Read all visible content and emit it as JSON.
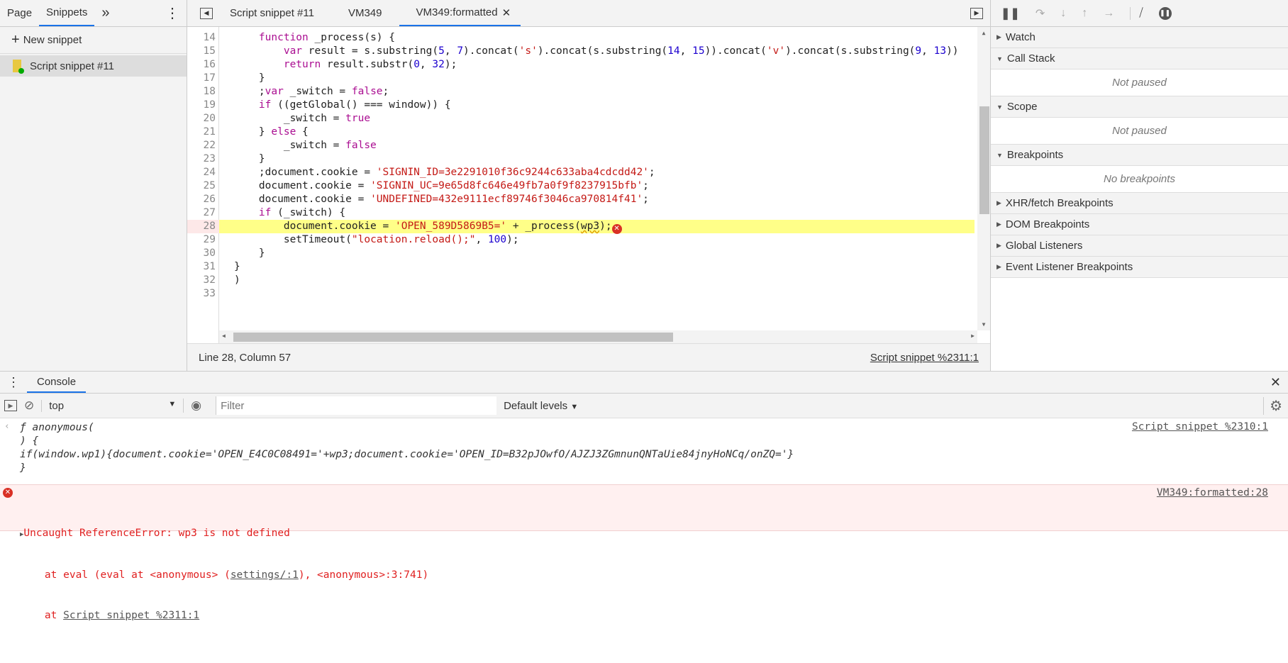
{
  "navigator": {
    "tabs": [
      "Page",
      "Snippets"
    ],
    "more": "»",
    "new_snippet": "New snippet",
    "items": [
      {
        "label": "Script snippet #11"
      }
    ]
  },
  "editor": {
    "tabs": [
      "Script snippet #11",
      "VM349",
      "VM349:formatted"
    ],
    "lines": [
      {
        "n": "14",
        "html": "    <span class='kw'>function</span> _process(s) {"
      },
      {
        "n": "15",
        "html": "        <span class='kw'>var</span> result = s.substring(<span class='nm'>5</span>, <span class='nm'>7</span>).concat(<span class='str'>'s'</span>).concat(s.substring(<span class='nm'>14</span>, <span class='nm'>15</span>)).concat(<span class='str'>'v'</span>).concat(s.substring(<span class='nm'>9</span>, <span class='nm'>13</span>))"
      },
      {
        "n": "16",
        "html": "        <span class='kw'>return</span> result.substr(<span class='nm'>0</span>, <span class='nm'>32</span>);"
      },
      {
        "n": "17",
        "html": "    }"
      },
      {
        "n": "18",
        "html": "    ;<span class='kw'>var</span> _switch = <span class='kw'>false</span>;"
      },
      {
        "n": "19",
        "html": "    <span class='kw'>if</span> ((getGlobal() === window)) {"
      },
      {
        "n": "20",
        "html": "        _switch = <span class='kw'>true</span>"
      },
      {
        "n": "21",
        "html": "    } <span class='kw'>else</span> {"
      },
      {
        "n": "22",
        "html": "        _switch = <span class='kw'>false</span>"
      },
      {
        "n": "23",
        "html": "    }"
      },
      {
        "n": "24",
        "html": "    ;document.cookie = <span class='str'>'SIGNIN_ID=3e2291010f36c9244c633aba4cdcdd42'</span>;"
      },
      {
        "n": "25",
        "html": "    document.cookie = <span class='str'>'SIGNIN_UC=9e65d8fc646e49fb7a0f9f8237915bfb'</span>;"
      },
      {
        "n": "26",
        "html": "    document.cookie = <span class='str'>'UNDEFINED=432e9111ecf89746f3046ca970814f41'</span>;"
      },
      {
        "n": "27",
        "html": "    <span class='kw'>if</span> (_switch) {"
      },
      {
        "n": "28",
        "html": "        document.cookie = <span class='str'>'OPEN_589D5869B5='</span> + _process(<span style='text-decoration:underline wavy #e0a000'>wp3</span>);<span style='display:inline-block;width:14px;height:14px;border-radius:7px;background:#d93025;color:#fff;font-size:10px;line-height:14px;text-align:center;font-family:DejaVu Sans,sans-serif;vertical-align:-2px'>✕</span>",
        "highlight": true
      },
      {
        "n": "29",
        "html": "        setTimeout(<span class='str'>\"location.reload();\"</span>, <span class='nm'>100</span>);"
      },
      {
        "n": "30",
        "html": "    }"
      },
      {
        "n": "31",
        "html": "}"
      },
      {
        "n": "32",
        "html": ")"
      },
      {
        "n": "33",
        "html": ""
      }
    ],
    "status_position": "Line 28, Column 57",
    "status_source": "Script snippet %2311:1"
  },
  "debugger": {
    "sections": [
      {
        "label": "Watch",
        "expanded": false
      },
      {
        "label": "Call Stack",
        "expanded": true,
        "empty": "Not paused"
      },
      {
        "label": "Scope",
        "expanded": true,
        "empty": "Not paused"
      },
      {
        "label": "Breakpoints",
        "expanded": true,
        "empty": "No breakpoints"
      },
      {
        "label": "XHR/fetch Breakpoints",
        "expanded": false
      },
      {
        "label": "DOM Breakpoints",
        "expanded": false
      },
      {
        "label": "Global Listeners",
        "expanded": false
      },
      {
        "label": "Event Listener Breakpoints",
        "expanded": false
      }
    ]
  },
  "console": {
    "tab": "Console",
    "context": "top",
    "filter_placeholder": "Filter",
    "levels": "Default levels",
    "result": {
      "lines": [
        "ƒ anonymous(",
        ") {",
        "if(window.wp1){document.cookie='OPEN_E4C0C08491='+wp3;document.cookie='OPEN_ID=B32pJOwfO/AJZJ3ZGmnunQNTaUie84jnyHoNCq/onZQ='}",
        "}"
      ],
      "source": "Script snippet %2310:1"
    },
    "error": {
      "message": "Uncaught ReferenceError: wp3 is not defined",
      "stack1_pre": "    at eval (eval at <anonymous> (",
      "stack1_link": "settings/:1",
      "stack1_post": "), <anonymous>:3:741)",
      "stack2_pre": "    at ",
      "stack2_link": "Script snippet %2311:1",
      "source": "VM349:formatted:28"
    }
  },
  "colors": {
    "accent": "#1a73e8",
    "highlight": "#ffff88",
    "error_bg": "#fff0f0",
    "error_text": "#e02020"
  }
}
